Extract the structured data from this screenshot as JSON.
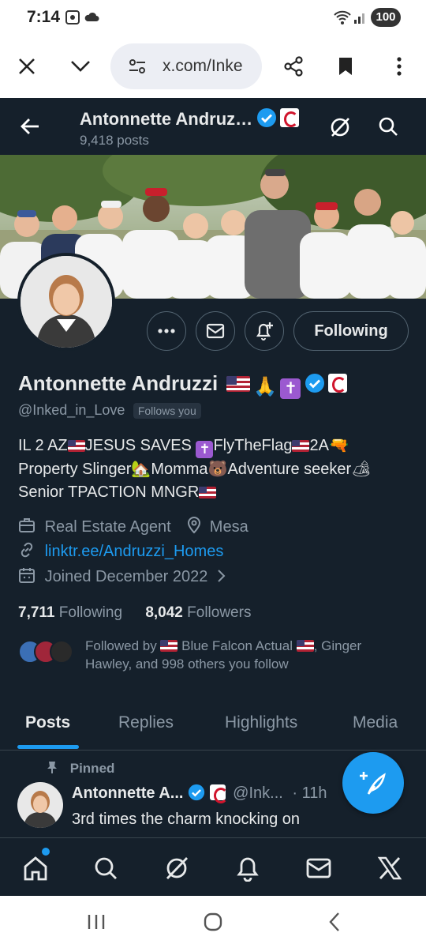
{
  "status_bar": {
    "time": "7:14",
    "battery": "100"
  },
  "browser": {
    "url": "x.com/Inke"
  },
  "header": {
    "name": "Antonnette Andruz…",
    "posts": "9,418 posts"
  },
  "profile": {
    "display_name": "Antonnette Andruzzi",
    "handle": "@Inked_in_Love",
    "follows_you": "Follows you",
    "following_button": "Following",
    "bio_line1_a": "IL 2 AZ",
    "bio_line1_b": "JESUS SAVES ",
    "bio_line1_c": "FlyTheFlag",
    "bio_line1_d": "2A",
    "bio_line2_a": "Property Slinger",
    "bio_line2_b": "Momma",
    "bio_line2_c": "Adventure seeker",
    "bio_line3_a": "Senior TPACTION MNGR",
    "job": "Real Estate Agent",
    "location": "Mesa",
    "website": "linktr.ee/Andruzzi_Homes",
    "joined": "Joined December 2022",
    "following_count": "7,711",
    "following_label": "Following",
    "followers_count": "8,042",
    "followers_label": "Followers",
    "followed_by_a": "Followed by ",
    "followed_by_b": " Blue Falcon Actual ",
    "followed_by_c": ", Ginger",
    "followed_by_line2": "Hawley, and 998 others you follow"
  },
  "tabs": [
    "Posts",
    "Replies",
    "Highlights",
    "Media"
  ],
  "pinned_post": {
    "pinned_label": "Pinned",
    "author": "Antonnette A...",
    "handle": "@Ink...",
    "time": "· 11h",
    "text": "3rd times  the charm knocking on"
  },
  "colors": {
    "accent": "#1d9bf0",
    "background": "#15202b",
    "muted": "#8b98a5"
  }
}
